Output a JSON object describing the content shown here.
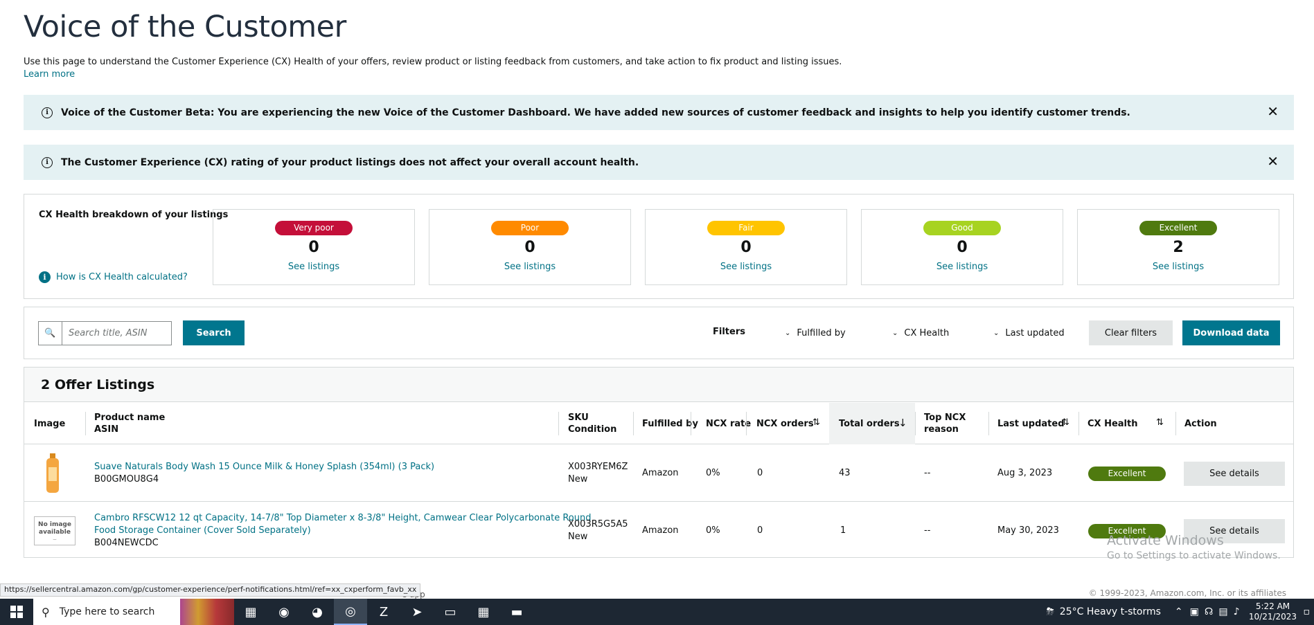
{
  "page": {
    "title": "Voice of the Customer",
    "description": "Use this page to understand the Customer Experience (CX) Health of your offers, review product or listing feedback from customers, and take action to fix product and listing issues.",
    "learn_more": "Learn more"
  },
  "alerts": [
    {
      "message": "Voice of the Customer Beta: You are experiencing the new Voice of the Customer Dashboard. We have added new sources of customer feedback and insights to help you identify customer trends."
    },
    {
      "message": "The Customer Experience (CX) rating of your product listings does not affect your overall account health."
    }
  ],
  "cx_health": {
    "title": "CX Health breakdown of your listings",
    "how_link": "How is CX Health calculated?",
    "cards": [
      {
        "label": "Very poor",
        "count": "0",
        "link": "See listings",
        "color": "#c40f39"
      },
      {
        "label": "Poor",
        "count": "0",
        "link": "See listings",
        "color": "#ff8a00"
      },
      {
        "label": "Fair",
        "count": "0",
        "link": "See listings",
        "color": "#ffc400"
      },
      {
        "label": "Good",
        "count": "0",
        "link": "See listings",
        "color": "#a7d321"
      },
      {
        "label": "Excellent",
        "count": "2",
        "link": "See listings",
        "color": "#4f7a0f"
      }
    ]
  },
  "filter_bar": {
    "search_placeholder": "Search title, ASIN",
    "search_button": "Search",
    "filters_label": "Filters",
    "dropdowns": [
      "Fulfilled by",
      "CX Health",
      "Last updated"
    ],
    "clear_button": "Clear filters",
    "download_button": "Download data"
  },
  "listings": {
    "title": "2 Offer Listings",
    "columns": {
      "image": "Image",
      "product_name": "Product name",
      "asin": "ASIN",
      "sku": "SKU",
      "condition": "Condition",
      "fulfilled_by": "Fulfilled by",
      "ncx_rate": "NCX rate",
      "ncx_orders": "NCX orders",
      "total_orders": "Total orders",
      "top_ncx_1": "Top NCX",
      "top_ncx_2": "reason",
      "last_updated": "Last updated",
      "cx_health": "CX Health",
      "action": "Action"
    },
    "rows": [
      {
        "name": "Suave Naturals Body Wash 15 Ounce Milk & Honey Splash (354ml) (3 Pack)",
        "asin": "B00GMOU8G4",
        "sku": "X003RYEM6Z",
        "condition": "New",
        "fulfilled_by": "Amazon",
        "ncx_rate": "0%",
        "ncx_orders": "0",
        "total_orders": "43",
        "top_ncx": "--",
        "last_updated": "Aug 3, 2023",
        "cx_health": "Excellent",
        "action": "See details"
      },
      {
        "name_line1": "Cambro RFSCW12 12 qt Capacity, 14-7/8\" Top Diameter x 8-3/8\" Height, Camwear Clear Polycarbonate Round",
        "name_line2": "Food Storage Container (Cover Sold Separately)",
        "asin": "B004NEWCDC",
        "sku": "X003R5G5A5",
        "condition": "New",
        "fulfilled_by": "Amazon",
        "ncx_rate": "0%",
        "ncx_orders": "0",
        "total_orders": "1",
        "top_ncx": "--",
        "last_updated": "May 30, 2023",
        "cx_health": "Excellent",
        "action": "See details",
        "no_image_1": "No image",
        "no_image_2": "available"
      }
    ]
  },
  "status_url": "https://sellercentral.amazon.com/gp/customer-experience/perf-notifications.html/ref=xx_cxperform_favb_xx",
  "footer_app": "e app",
  "copyright": "© 1999-2023, Amazon.com, Inc. or its affiliates",
  "watermark": {
    "line1": "Activate Windows",
    "line2": "Go to Settings to activate Windows."
  },
  "taskbar": {
    "search_placeholder": "Type here to search",
    "weather": "25°C  Heavy t-storms",
    "time": "5:22 AM",
    "date": "10/21/2023"
  }
}
